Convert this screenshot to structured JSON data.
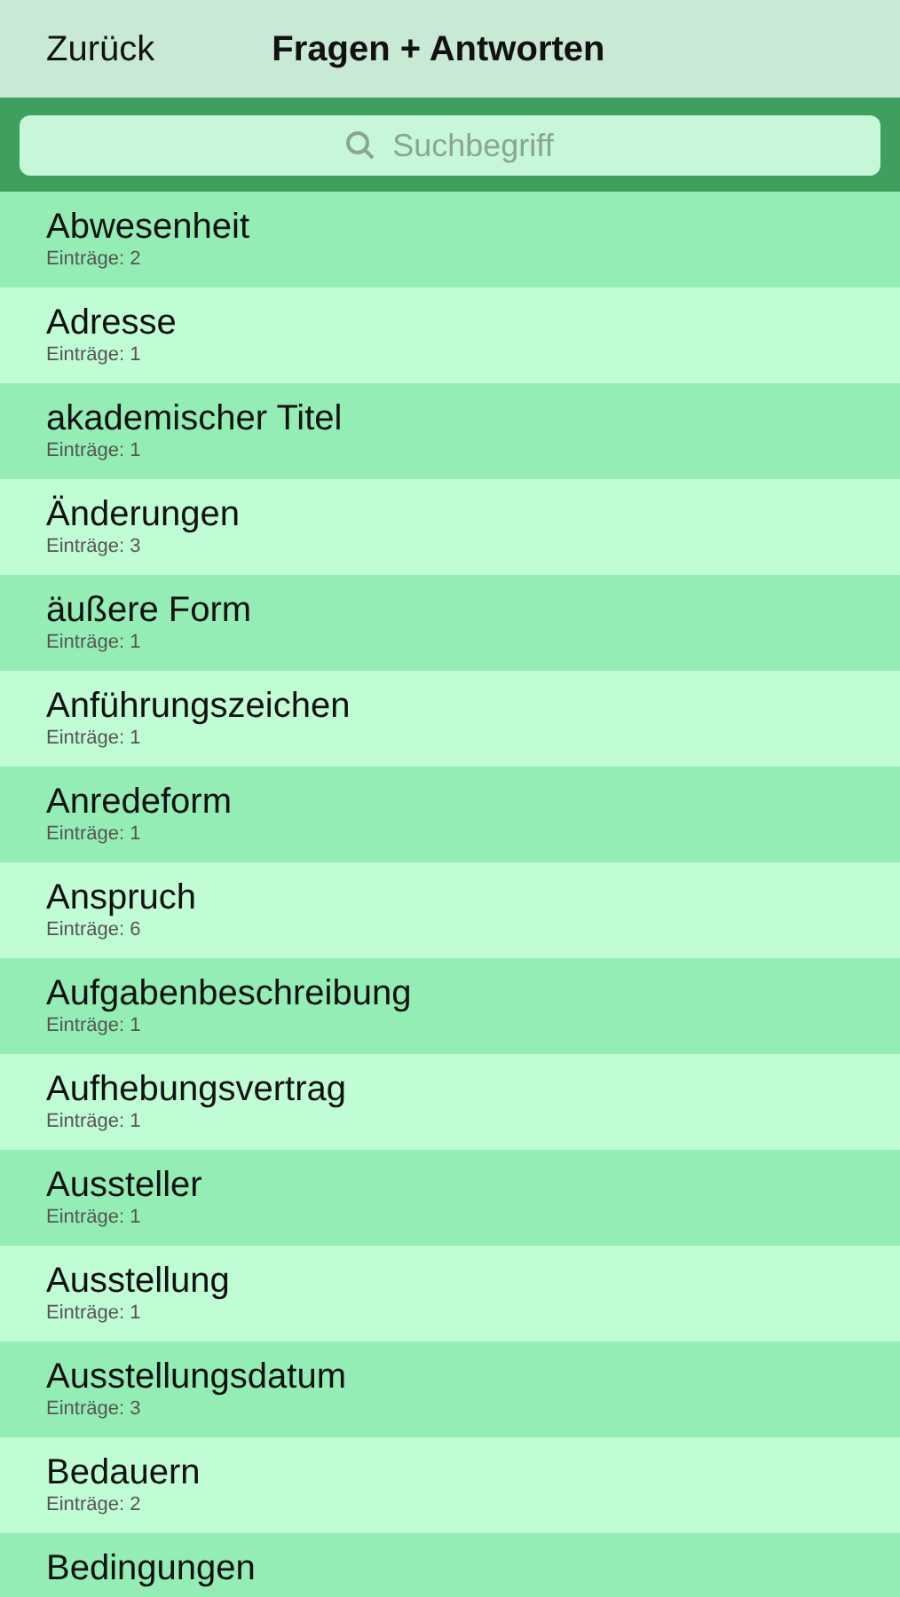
{
  "nav_bar": {
    "back": "Zurück",
    "title": "Fragen + Antworten"
  },
  "search": {
    "placeholder": "Suchbegriff"
  },
  "items": [
    {
      "title": "Abwesenheit",
      "count": "Einträge: 2"
    },
    {
      "title": "Adresse",
      "count": "Einträge: 1"
    },
    {
      "title": "akademischer Titel",
      "count": "Einträge: 1"
    },
    {
      "title": "Änderungen",
      "count": "Einträge: 3"
    },
    {
      "title": "äußere Form",
      "count": "Einträge: 1"
    },
    {
      "title": "Anführungszeichen",
      "count": "Einträge: 1"
    },
    {
      "title": "Anredeform",
      "count": "Einträge: 1"
    },
    {
      "title": "Anspruch",
      "count": "Einträge: 6"
    },
    {
      "title": "Aufgabenbeschreibung",
      "count": "Einträge: 1"
    },
    {
      "title": "Aufhebungsvertrag",
      "count": "Einträge: 1"
    },
    {
      "title": "Aussteller",
      "count": "Einträge: 1"
    },
    {
      "title": "Ausstellung",
      "count": "Einträge: 1"
    },
    {
      "title": "Ausstellungsdatum",
      "count": "Einträge: 3"
    },
    {
      "title": "Bedauern",
      "count": "Einträge: 2"
    },
    {
      "title": "Bedingungen"
    }
  ]
}
